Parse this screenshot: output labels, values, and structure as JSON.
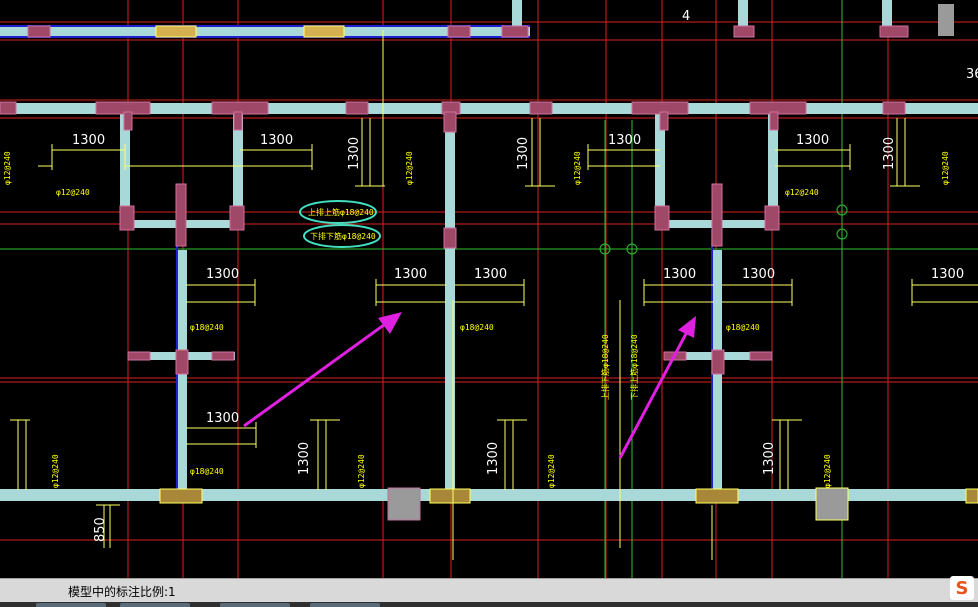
{
  "drawing": {
    "top_label": "4",
    "edge_label": "36",
    "dimension_1300": "1300",
    "dimension_850": "850",
    "rebar_12": "φ12@240",
    "rebar_18": "φ18@240",
    "annotation_top": "上排上筋φ18@240",
    "annotation_bottom": "下排下筋φ18@240",
    "annotation_vertical_1": "上排下筋φ18@240",
    "annotation_vertical_2": "下排上筋φ18@240"
  },
  "status_bar": {
    "scale_text": "模型中的标注比例:1"
  },
  "icons": {
    "ime": "sogou-input-icon"
  },
  "colors": {
    "wall": "#a8d8d8",
    "column": "#9a9a9a",
    "beam_pink": "#b05070",
    "axis_red": "#e02020",
    "axis_green": "#30d030",
    "dim_yellow": "#ffff66",
    "highlight_cyan": "#40e0c0",
    "arrow": "#e020e0"
  }
}
